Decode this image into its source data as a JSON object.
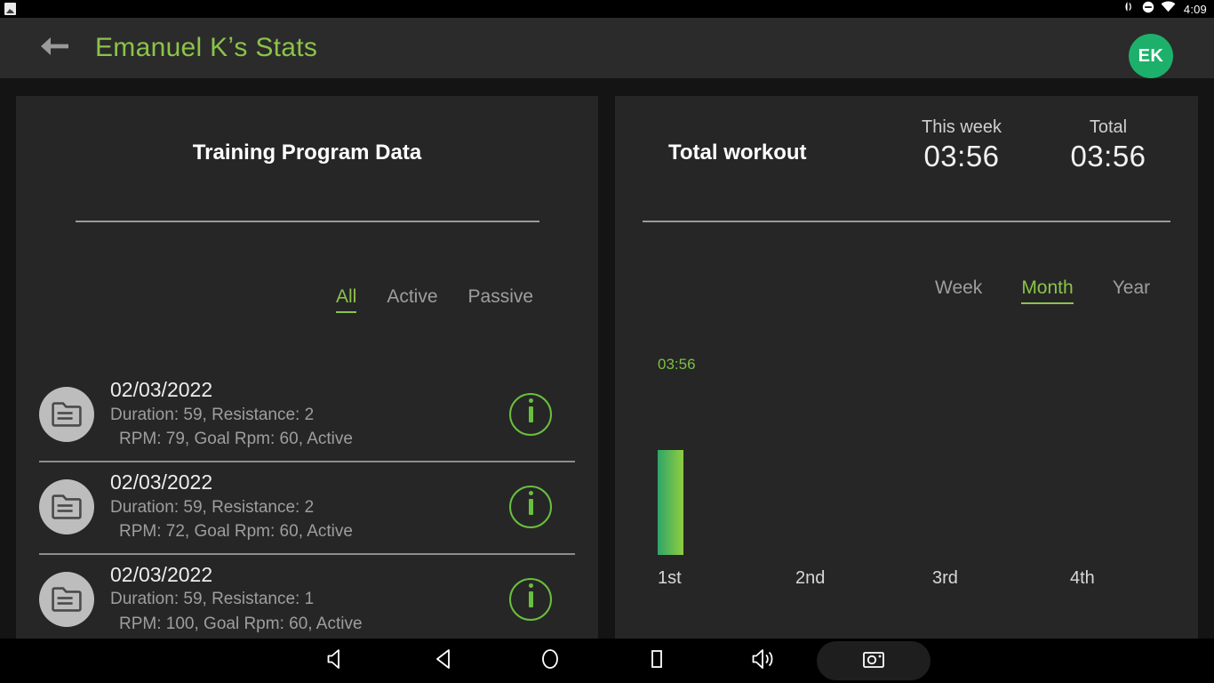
{
  "statusbar": {
    "time": "4:09",
    "icons": [
      "image-app-icon",
      "vibrate-icon",
      "do-not-disturb-icon",
      "wifi-icon"
    ]
  },
  "appbar": {
    "back_icon": "back-arrow-icon",
    "title": "Emanuel Kʼs Stats",
    "avatar_initials": "EK",
    "title_color": "#8bc34a",
    "avatar_color": "#1db06b"
  },
  "left_card": {
    "title": "Training Program Data",
    "tabs": [
      {
        "label": "All",
        "active": true
      },
      {
        "label": "Active",
        "active": false
      },
      {
        "label": "Passive",
        "active": false
      }
    ],
    "items": [
      {
        "icon": "folder-icon",
        "date": "02/03/2022",
        "line1": "Duration: 59, Resistance: 2",
        "line2": "RPM: 79, Goal Rpm: 60, Active",
        "info_icon": "info-icon"
      },
      {
        "icon": "folder-icon",
        "date": "02/03/2022",
        "line1": "Duration: 59, Resistance: 2",
        "line2": "RPM: 72, Goal Rpm: 60, Active",
        "info_icon": "info-icon"
      },
      {
        "icon": "folder-icon",
        "date": "02/03/2022",
        "line1": "Duration: 59, Resistance: 1",
        "line2": "RPM: 100, Goal Rpm: 60, Active",
        "info_icon": "info-icon"
      }
    ]
  },
  "right_card": {
    "title": "Total workout",
    "stats": [
      {
        "label": "This week",
        "value": "03:56"
      },
      {
        "label": "Total",
        "value": "03:56"
      }
    ],
    "tabs": [
      {
        "label": "Week",
        "active": false
      },
      {
        "label": "Month",
        "active": true
      },
      {
        "label": "Year",
        "active": false
      }
    ]
  },
  "chart_data": {
    "type": "bar",
    "title": "Total workout",
    "categories": [
      "1st",
      "2nd",
      "3rd",
      "4th"
    ],
    "values": [
      3.933,
      0,
      0,
      0
    ],
    "value_labels": [
      "03:56",
      "",
      "",
      ""
    ],
    "xlabel": "",
    "ylabel": "",
    "ylim": [
      0,
      10
    ],
    "grid": false,
    "legend": "none",
    "bar_color_start": "#2fa56a",
    "bar_color_end": "#8fce3f",
    "label_color": "#7bc043"
  },
  "navbar": {
    "buttons": [
      "volume-down-icon",
      "back-triangle-icon",
      "home-circle-icon",
      "recents-square-icon",
      "volume-up-icon",
      "screenshot-camera-icon"
    ]
  }
}
